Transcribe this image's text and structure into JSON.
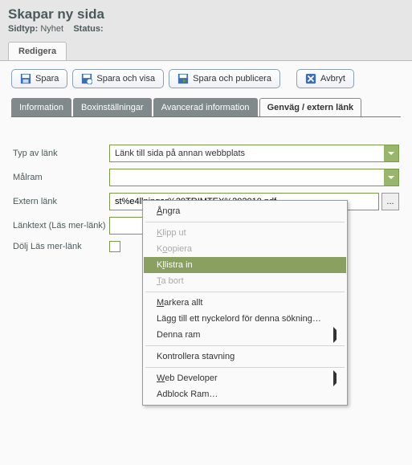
{
  "header": {
    "title": "Skapar ny sida",
    "sidtyp_label": "Sidtyp:",
    "sidtyp_value": "Nyhet",
    "status_label": "Status:"
  },
  "main_tab": "Redigera",
  "toolbar": {
    "save": "Spara",
    "save_view": "Spara och visa",
    "save_publish": "Spara och publicera",
    "cancel": "Avbryt"
  },
  "subtabs": {
    "t1": "Information",
    "t2": "Boxinställningar",
    "t3": "Avancerad information",
    "t4": "Genväg / extern länk"
  },
  "form": {
    "typ_label": "Typ av länk",
    "typ_value": "Länk till sida på annan webbplats",
    "malram_label": "Målram",
    "malram_value": "",
    "extern_label": "Extern länk",
    "extern_value": "st%e4llningar%20TRIMTEX%202010.pdf",
    "lanktext_label": "Länktext (Läs mer-länk)",
    "dolj_label": "Dölj Läs mer-länk",
    "browse": "..."
  },
  "ctx": {
    "undo": "ngra",
    "cut": "lipp ut",
    "copy": "opiera",
    "paste": "listra in",
    "delete": "a bort",
    "selectall": "arkera allt",
    "addkw": "Lägg till ett nyckelord för denna sökning…",
    "frame": "Denna ram",
    "spell": "Kontrollera stavning",
    "webdev": "eb Developer",
    "adblock": "Adblock Ram…"
  }
}
